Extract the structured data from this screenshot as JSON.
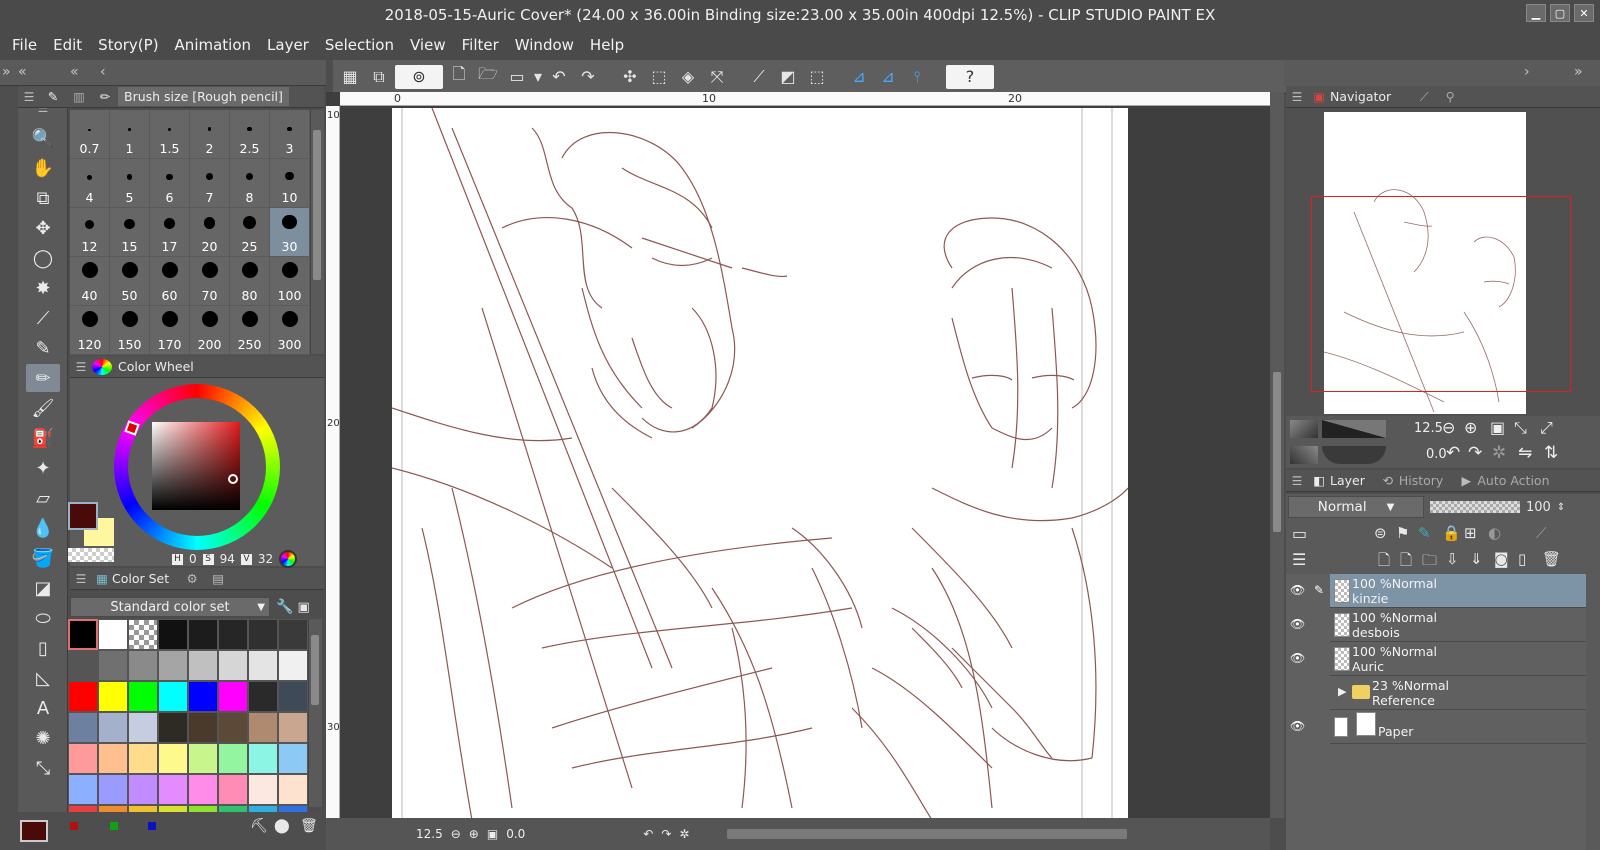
{
  "window": {
    "title": "2018-05-15-Auric Cover* (24.00 x 36.00in Binding size:23.00 x 35.00in 400dpi 12.5%)  - CLIP STUDIO PAINT EX"
  },
  "menu": [
    "File",
    "Edit",
    "Story(P)",
    "Animation",
    "Layer",
    "Selection",
    "View",
    "Filter",
    "Window",
    "Help"
  ],
  "brush_panel": {
    "title": "Brush size [Rough pencil]",
    "sizes": [
      "0.7",
      "1",
      "1.5",
      "2",
      "2.5",
      "3",
      "4",
      "5",
      "6",
      "7",
      "8",
      "10",
      "12",
      "15",
      "17",
      "20",
      "25",
      "30",
      "40",
      "50",
      "60",
      "70",
      "80",
      "100",
      "120",
      "150",
      "170",
      "200",
      "250",
      "300"
    ],
    "selected": "30"
  },
  "color_wheel": {
    "title": "Color Wheel",
    "h": "0",
    "s": "94",
    "v": "32",
    "main_color": "#4a0a0a",
    "sub_color": "#fff6a0",
    "h_tag": "H",
    "s_tag": "S",
    "v_tag": "V"
  },
  "color_set": {
    "title": "Color Set",
    "selected_set": "Standard color set",
    "swatches": [
      "#000000",
      "#ffffff",
      "checker",
      "#111111",
      "#1c1c1c",
      "#262626",
      "#303030",
      "#3a3a3a",
      "#555555",
      "#707070",
      "#8a8a8a",
      "#a5a5a5",
      "#c0c0c0",
      "#d6d6d6",
      "#e4e4e4",
      "#f0f0f0",
      "#ff0000",
      "#ffff00",
      "#00ff00",
      "#00ffff",
      "#0000ff",
      "#ff00ff",
      "#2a2a2a",
      "#3e4a58",
      "#6e80a0",
      "#a4b0cc",
      "#c6cde0",
      "#2e2a24",
      "#4a3a2c",
      "#5c4a38",
      "#b08a70",
      "#c8a690",
      "#ff9a9a",
      "#ffbf8f",
      "#ffdc8c",
      "#fdf98c",
      "#c8f58c",
      "#94f5a0",
      "#8cf5e4",
      "#8ccaf5",
      "#8cb0ff",
      "#9a9aff",
      "#c08cff",
      "#e48cff",
      "#ff8ce8",
      "#ff8cb4",
      "#fbe8e0",
      "#fde2d0",
      "#e84040",
      "#f08c30",
      "#f0c030",
      "#d8e030",
      "#90e030",
      "#30c070",
      "#30b0e0",
      "#3070e0"
    ]
  },
  "canvas": {
    "ruler_h": [
      "0",
      "10",
      "20"
    ],
    "ruler_v": [
      "10",
      "20",
      "30"
    ],
    "zoom": "12.5",
    "rotation": "0.0"
  },
  "navigator": {
    "title": "Navigator",
    "zoom": "12.5",
    "rotation": "0.0"
  },
  "layer_panel": {
    "tabs": [
      "Layer",
      "History",
      "Auto Action"
    ],
    "blend_mode": "Normal",
    "opacity": "100",
    "layers": [
      {
        "opacity": "100 %",
        "mode": "Normal",
        "name": "kinzie",
        "selected": true,
        "visible": true
      },
      {
        "opacity": "100 %",
        "mode": "Normal",
        "name": "desbois",
        "selected": false,
        "visible": true
      },
      {
        "opacity": "100 %",
        "mode": "Normal",
        "name": "Auric",
        "selected": false,
        "visible": true
      },
      {
        "opacity": "23 %",
        "mode": "Normal",
        "name": "Reference",
        "selected": false,
        "visible": false,
        "folder": true
      },
      {
        "opacity": "",
        "mode": "",
        "name": "Paper",
        "selected": false,
        "visible": true
      }
    ]
  },
  "colors": {
    "sketch": "#7a3a34",
    "panel": "#5a5a5a",
    "selection": "#7d93a6"
  }
}
